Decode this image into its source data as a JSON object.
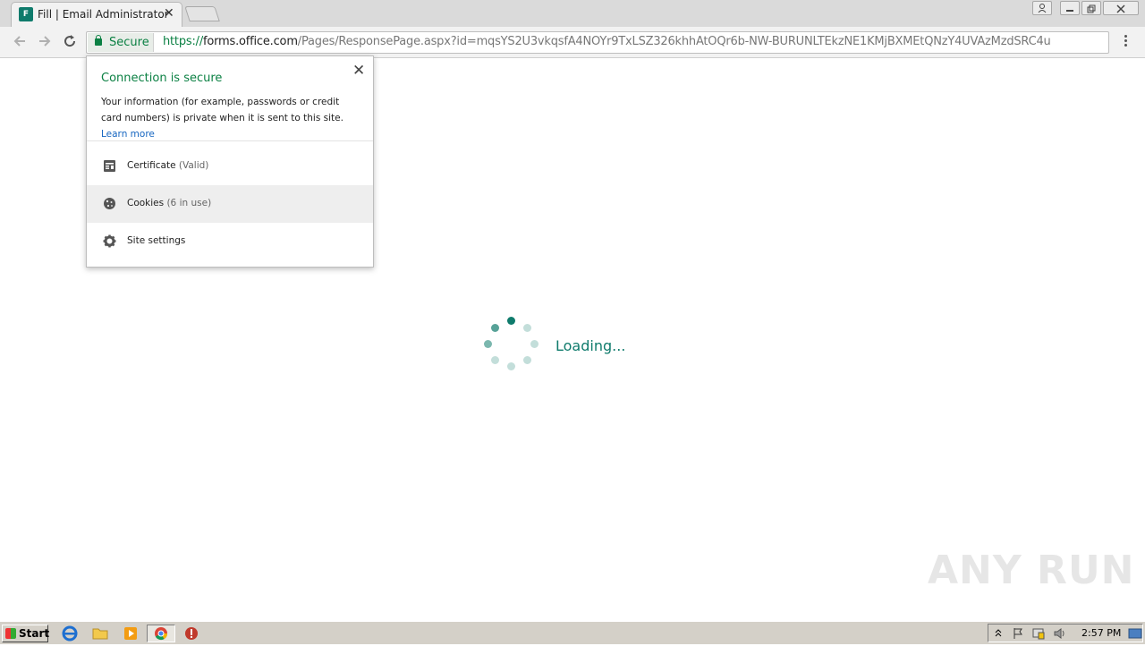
{
  "browser": {
    "tab_title": "Fill | Email Administrator",
    "tab_favicon_text": "F",
    "secure_label": "Secure",
    "url_scheme": "https://",
    "url_host": "forms.office.com",
    "url_path": "/Pages/ResponsePage.aspx?id=mqsYS2U3vkqsfA4NOYr9TxLSZ326khhAtOQr6b-NW-BURUNLTEkzNE1KMjBXMEtQNzY4UVAzMzdSRC4u"
  },
  "popup": {
    "title": "Connection is secure",
    "description": "Your information (for example, passwords or credit card numbers) is private when it is sent to this site.",
    "learn_more": "Learn more",
    "rows": [
      {
        "label": "Certificate",
        "detail": "(Valid)",
        "icon": "certificate-icon"
      },
      {
        "label": "Cookies",
        "detail": "(6 in use)",
        "icon": "cookie-icon"
      },
      {
        "label": "Site settings",
        "detail": "",
        "icon": "gear-icon"
      }
    ]
  },
  "page": {
    "loading_text": "Loading..."
  },
  "watermark": "ANY RUN",
  "taskbar": {
    "start_label": "Start",
    "clock": "2:57 PM",
    "apps": [
      "internet-explorer-icon",
      "folder-icon",
      "media-player-icon",
      "chrome-icon",
      "stop-icon"
    ]
  },
  "colors": {
    "secure_green": "#0b8043",
    "forms_teal": "#0f7b6c",
    "link_blue": "#1565c0"
  }
}
